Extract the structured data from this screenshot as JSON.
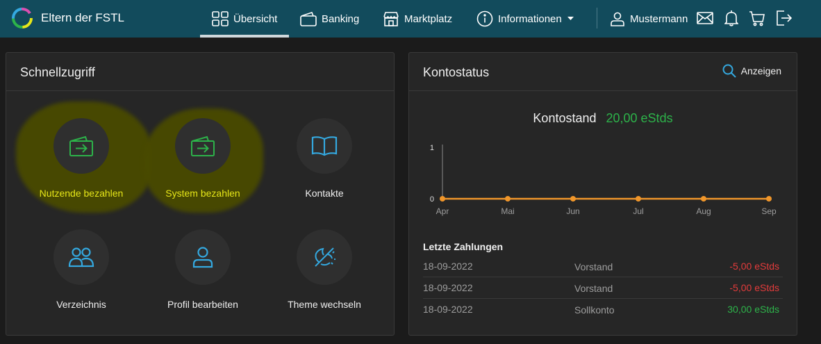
{
  "brand": {
    "title": "Eltern der FSTL"
  },
  "nav": {
    "overview": "Übersicht",
    "banking": "Banking",
    "market": "Marktplatz",
    "info": "Informationen",
    "user": "Mustermann"
  },
  "colors": {
    "navbar": "#124b5c",
    "accent_green": "#2db34a",
    "accent_blue": "#34a9e0",
    "negative": "#e33b3b",
    "highlight_text": "#e6e619",
    "chart_line": "#f0962a"
  },
  "quick": {
    "title": "Schnellzugriff",
    "items": [
      {
        "label": "Nutzende bezahlen",
        "icon": "wallet-transfer-icon"
      },
      {
        "label": "System bezahlen",
        "icon": "wallet-transfer-icon"
      },
      {
        "label": "Kontakte",
        "icon": "open-book-icon"
      },
      {
        "label": "Verzeichnis",
        "icon": "users-icon"
      },
      {
        "label": "Profil bearbeiten",
        "icon": "user-icon"
      },
      {
        "label": "Theme wechseln",
        "icon": "theme-toggle-icon"
      }
    ]
  },
  "account": {
    "title": "Kontostatus",
    "show_label": "Anzeigen",
    "balance_label": "Kontostand",
    "balance_value": "20,00 eStds"
  },
  "chart_data": {
    "type": "line",
    "categories": [
      "Apr",
      "Mai",
      "Jun",
      "Jul",
      "Aug",
      "Sep"
    ],
    "values": [
      0,
      0,
      0,
      0,
      0,
      0
    ],
    "yticks": [
      0,
      1
    ],
    "ylim": [
      0,
      1
    ],
    "grid": false
  },
  "payments": {
    "title": "Letzte Zahlungen",
    "rows": [
      {
        "date": "18-09-2022",
        "desc": "Vorstand",
        "amount": "-5,00 eStds"
      },
      {
        "date": "18-09-2022",
        "desc": "Vorstand",
        "amount": "-5,00 eStds"
      },
      {
        "date": "18-09-2022",
        "desc": "Sollkonto",
        "amount": "30,00 eStds"
      }
    ]
  }
}
